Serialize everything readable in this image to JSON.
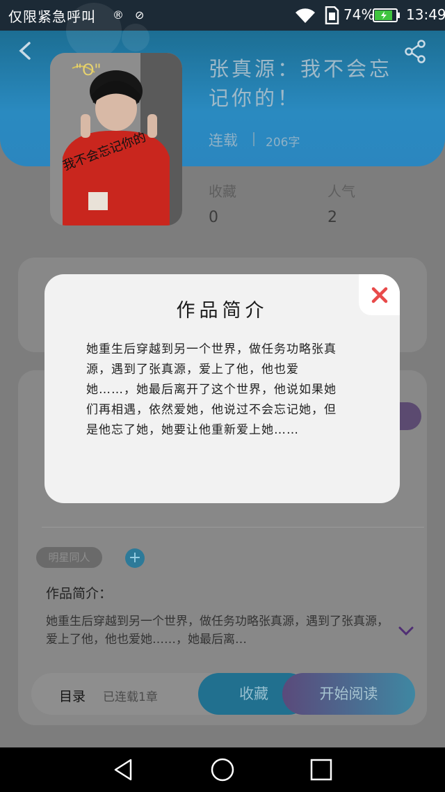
{
  "status_bar": {
    "carrier": "仅限紧急呼叫",
    "icon1": "copyright-icon",
    "icon2": "sync-icon",
    "battery_percent": "74%",
    "time": "13:49"
  },
  "book": {
    "title": "张真源：我不会忘记你的！",
    "status": "连载",
    "word_count": "206字",
    "stats": [
      {
        "label": "收藏",
        "value": "0"
      },
      {
        "label": "人气",
        "value": "2"
      }
    ],
    "cover_caption": "我不会忘记你的",
    "tag": "明星同人",
    "intro_label": "作品简介：",
    "intro_preview": "她重生后穿越到另一个世界，做任务功略张真源，遇到了张真源，爱上了他，他也爱她……，她最后离…"
  },
  "bottom_bar": {
    "toc_label": "目录",
    "chapters": "已连载1章",
    "favorite_label": "收藏",
    "read_label": "开始阅读"
  },
  "modal": {
    "title": "作品简介",
    "body": "她重生后穿越到另一个世界，做任务功略张真源，遇到了张真源，爱上了他，他也爱她……，她最后离开了这个世界，他说如果她们再相遇，依然爱她，他说过不会忘记她，但是他忘了她，她要让他重新爱上她……"
  },
  "colors": {
    "header_blue": "#2a8ac0",
    "close_red": "#e84a4a",
    "accent_purple": "#7e57c2"
  }
}
